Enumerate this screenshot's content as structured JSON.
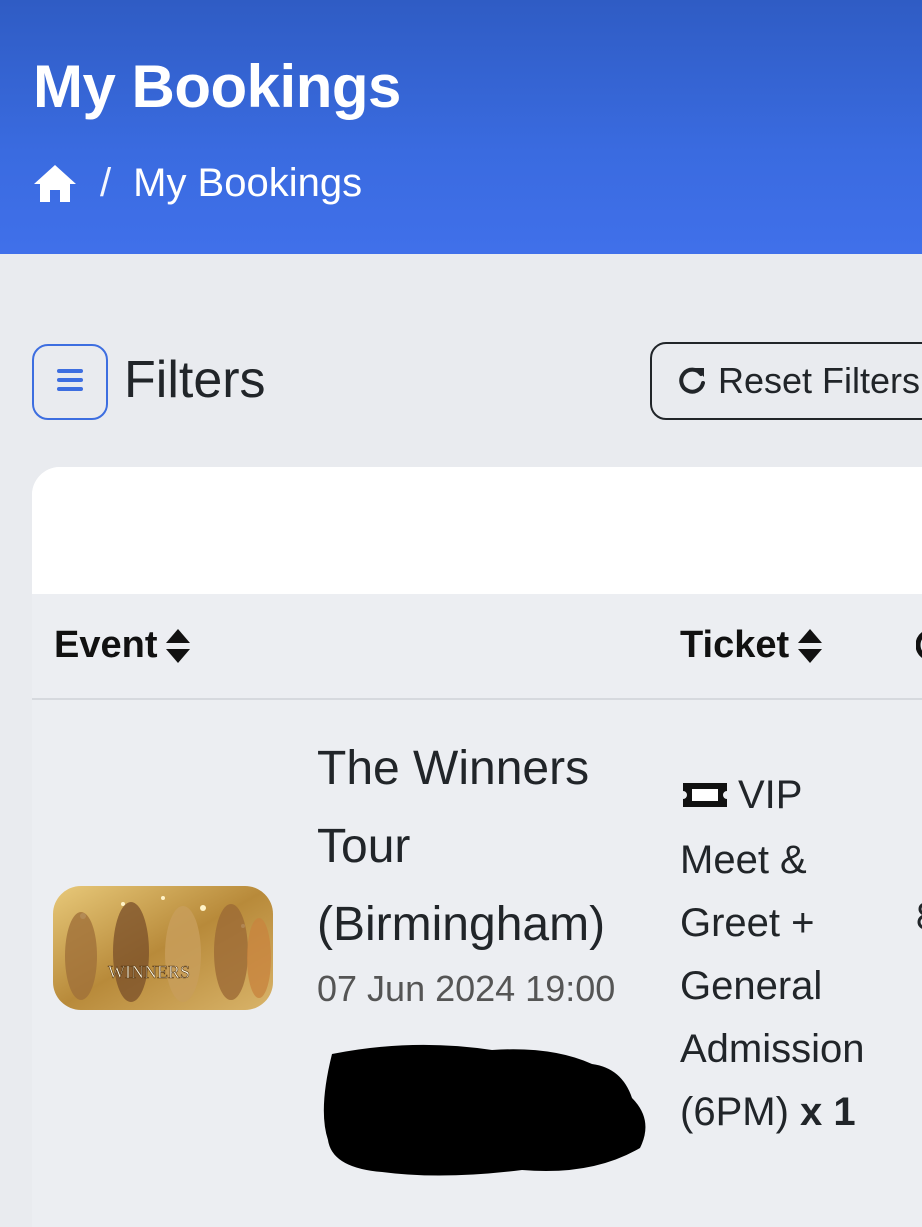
{
  "header": {
    "title": "My Bookings",
    "breadcrumb": {
      "home_icon": "home-icon",
      "separator": "/",
      "current": "My Bookings"
    }
  },
  "filters": {
    "toggle_icon": "hamburger-menu-icon",
    "title": "Filters",
    "reset_label": "Reset Filters",
    "reset_icon": "refresh-icon"
  },
  "table": {
    "columns": [
      {
        "label": "Event",
        "sort_icon": "sort-icon"
      },
      {
        "label": "Ticket",
        "sort_icon": "sort-icon"
      }
    ],
    "rows": [
      {
        "event_name": "The Winners Tour (Birmingham)",
        "event_date": "07 Jun 2024 19:00",
        "thumbnail_text": "WINNERS",
        "ticket_icon": "ticket-icon",
        "ticket_name": "VIP Meet & Greet + General Admission (6PM)",
        "quantity": "x 1"
      }
    ]
  },
  "colors": {
    "header_top": "#2f5cc4",
    "header_bottom": "#4070ea",
    "accent": "#3d6ee0",
    "page_bg": "#e9ebef"
  }
}
